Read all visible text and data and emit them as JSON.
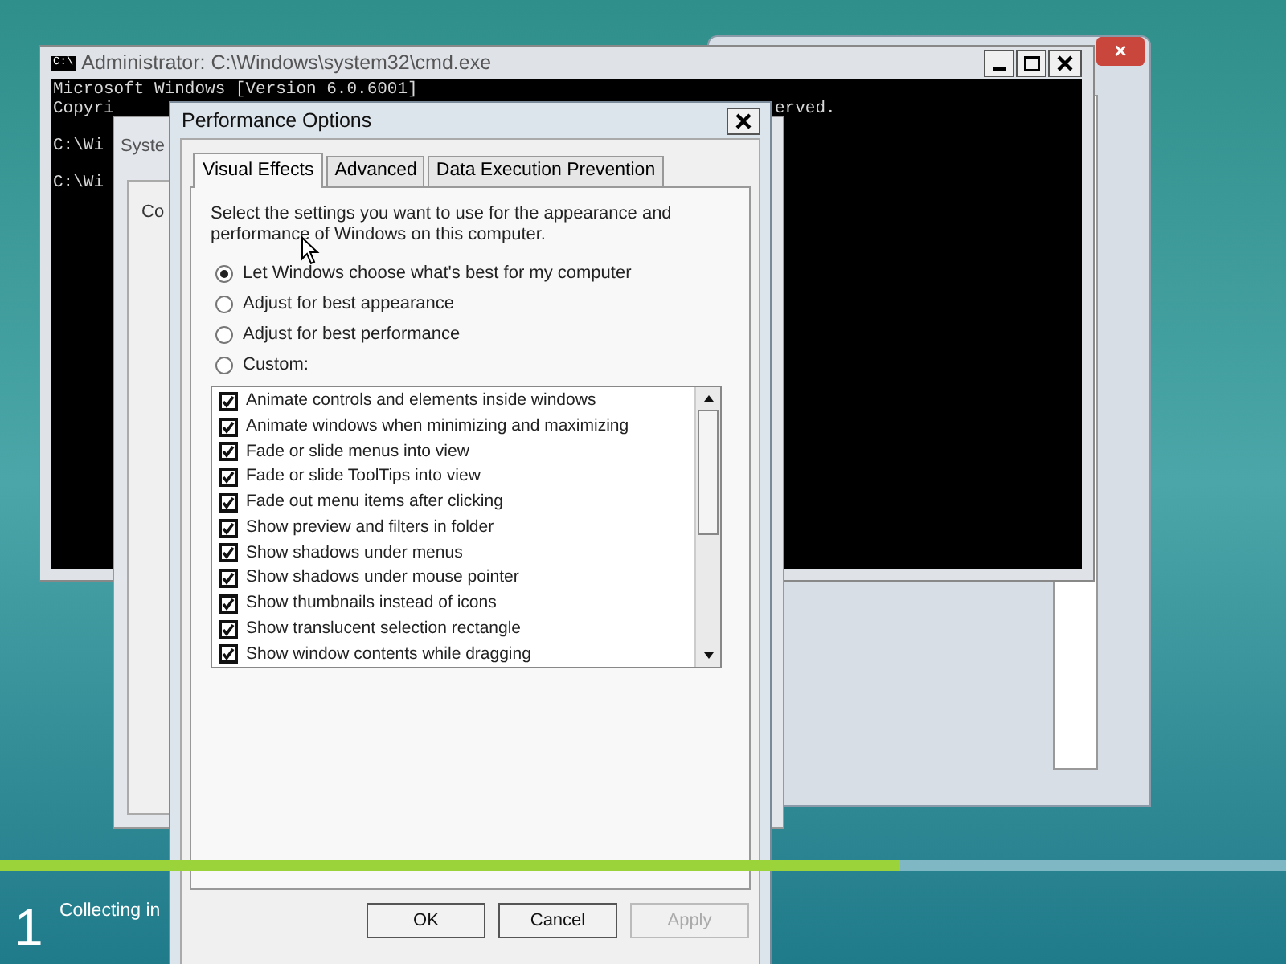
{
  "back_window": {
    "close_symbol": "×"
  },
  "cmd_window": {
    "title": "Administrator: C:\\Windows\\system32\\cmd.exe",
    "icon_text": "C:\\",
    "blocks": [
      [
        "Microsoft Windows [Version 6.0.6001]",
        "Copyri"
      ],
      [
        "C:\\Wi"
      ],
      [
        "C:\\Wi"
      ]
    ],
    "right_fragment": "erved."
  },
  "system_window": {
    "title": "Syste",
    "tab": "Co"
  },
  "performance_dialog": {
    "title": "Performance Options",
    "tabs": [
      {
        "label": "Visual Effects",
        "selected": true
      },
      {
        "label": "Advanced",
        "selected": false
      },
      {
        "label": "Data Execution Prevention",
        "selected": false
      }
    ],
    "intro": "Select the settings you want to use for the appearance and performance of Windows on this computer.",
    "options": [
      {
        "label": "Let Windows choose what's best for my computer",
        "selected": true
      },
      {
        "label": "Adjust for best appearance",
        "selected": false
      },
      {
        "label": "Adjust for best performance",
        "selected": false
      },
      {
        "label": "Custom:",
        "selected": false
      }
    ],
    "effects": [
      {
        "label": "Animate controls and elements inside windows",
        "checked": true
      },
      {
        "label": "Animate windows when minimizing and maximizing",
        "checked": true
      },
      {
        "label": "Fade or slide menus into view",
        "checked": true
      },
      {
        "label": "Fade or slide ToolTips into view",
        "checked": true
      },
      {
        "label": "Fade out menu items after clicking",
        "checked": true
      },
      {
        "label": "Show preview and filters in folder",
        "checked": true
      },
      {
        "label": "Show shadows under menus",
        "checked": true
      },
      {
        "label": "Show shadows under mouse pointer",
        "checked": true
      },
      {
        "label": "Show thumbnails instead of icons",
        "checked": true
      },
      {
        "label": "Show translucent selection rectangle",
        "checked": true
      },
      {
        "label": "Show window contents while dragging",
        "checked": true
      }
    ],
    "buttons": [
      {
        "label": "OK",
        "disabled": false
      },
      {
        "label": "Cancel",
        "disabled": false
      },
      {
        "label": "Apply",
        "disabled": true
      }
    ]
  },
  "setup": {
    "step": "1",
    "status": "Collecting in",
    "level": 0.7
  }
}
